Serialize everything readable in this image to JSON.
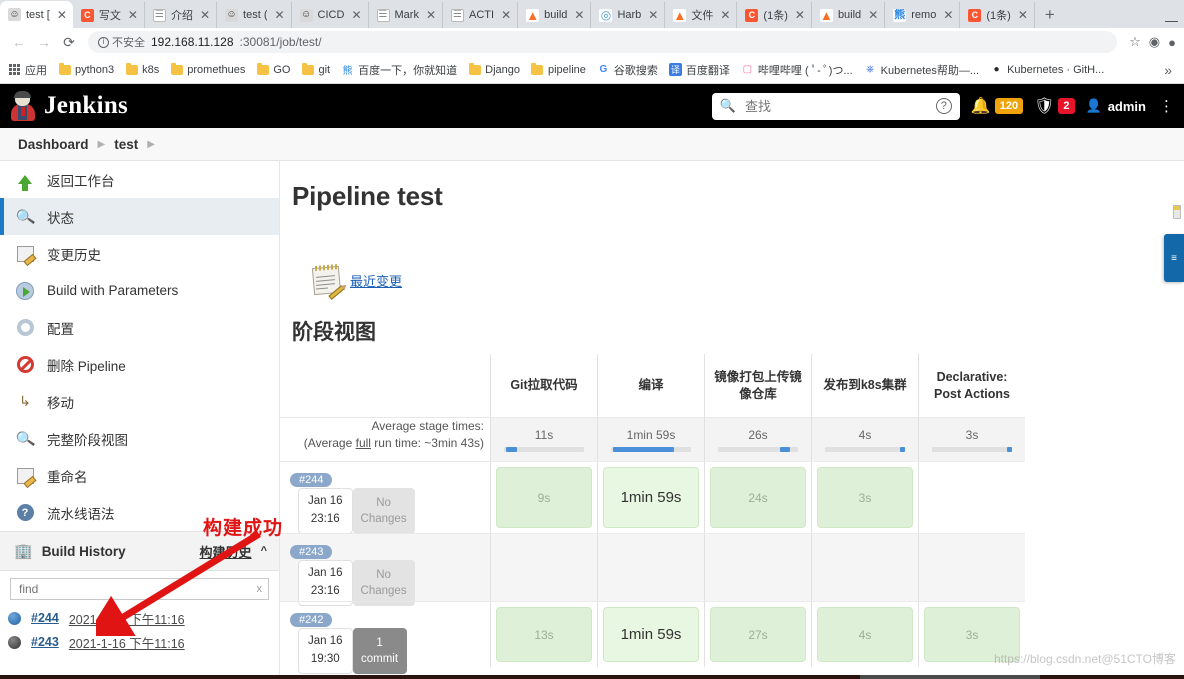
{
  "browser": {
    "tabs": [
      {
        "label": "test [",
        "icon": "jenkins-favicon",
        "active": true
      },
      {
        "label": "写文",
        "icon": "csdn-favicon",
        "active": false
      },
      {
        "label": "介绍",
        "icon": "doc-favicon",
        "active": false
      },
      {
        "label": "test (",
        "icon": "jenkins-favicon",
        "active": false
      },
      {
        "label": "CICD",
        "icon": "jenkins-favicon",
        "active": false
      },
      {
        "label": "Mark",
        "icon": "doc-favicon",
        "active": false
      },
      {
        "label": "ACTI",
        "icon": "doc-favicon",
        "active": false
      },
      {
        "label": "build",
        "icon": "gitlab-favicon",
        "active": false
      },
      {
        "label": "Harb",
        "icon": "harbor-favicon",
        "active": false
      },
      {
        "label": "文件",
        "icon": "gitlab-favicon",
        "active": false
      },
      {
        "label": "(1条)",
        "icon": "csdn-favicon",
        "active": false
      },
      {
        "label": "build",
        "icon": "gitlab-favicon",
        "active": false
      },
      {
        "label": "remo",
        "icon": "baidu-favicon",
        "active": false
      },
      {
        "label": "(1条)",
        "icon": "csdn-favicon",
        "active": false
      }
    ],
    "new_tab_label": "+",
    "minimize_label": "—",
    "security_label": "不安全",
    "url_host": "192.168.11.128",
    "url_rest": ":30081/job/test/",
    "bookmarks": [
      {
        "label": "应用",
        "icon": "apps-grid-icon"
      },
      {
        "label": "python3",
        "icon": "folder-icon"
      },
      {
        "label": "k8s",
        "icon": "folder-icon"
      },
      {
        "label": "promethues",
        "icon": "folder-icon"
      },
      {
        "label": "GO",
        "icon": "folder-icon"
      },
      {
        "label": "git",
        "icon": "folder-icon"
      },
      {
        "label": "百度一下，你就知道",
        "icon": "baidu-icon"
      },
      {
        "label": "Django",
        "icon": "folder-icon"
      },
      {
        "label": "pipeline",
        "icon": "folder-icon"
      },
      {
        "label": "谷歌搜索",
        "icon": "google-icon"
      },
      {
        "label": "百度翻译",
        "icon": "translate-icon"
      },
      {
        "label": "哔哩哔哩 ( ﾟ- ﾟ)つ...",
        "icon": "bilibili-icon"
      },
      {
        "label": "Kubernetes帮助—...",
        "icon": "kubernetes-icon"
      },
      {
        "label": "Kubernetes · GitH...",
        "icon": "github-icon"
      }
    ],
    "bookmarks_overflow": "»"
  },
  "jenkins": {
    "brand": "Jenkins",
    "search_placeholder": "查找",
    "search_value": "",
    "notification_count": "120",
    "alert_count": "2",
    "user": "admin",
    "breadcrumbs": [
      "Dashboard",
      "test"
    ],
    "sidebar": [
      {
        "label": "返回工作台",
        "icon": "up-arrow-icon",
        "active": false
      },
      {
        "label": "状态",
        "icon": "magnifier-icon",
        "active": true
      },
      {
        "label": "变更历史",
        "icon": "notepad-pencil-icon",
        "active": false
      },
      {
        "label": "Build with Parameters",
        "icon": "play-param-icon",
        "active": false
      },
      {
        "label": "配置",
        "icon": "gear-icon",
        "active": false
      },
      {
        "label": "删除 Pipeline",
        "icon": "delete-icon",
        "active": false
      },
      {
        "label": "移动",
        "icon": "move-icon",
        "active": false
      },
      {
        "label": "完整阶段视图",
        "icon": "magnifier-icon",
        "active": false
      },
      {
        "label": "重命名",
        "icon": "notepad-pencil-icon",
        "active": false
      },
      {
        "label": "流水线语法",
        "icon": "help-icon",
        "active": false
      }
    ],
    "build_history": {
      "title": "Build History",
      "link_label": "构建历史",
      "collapse_icon": "chevron-up-icon",
      "find_placeholder": "find",
      "find_value": "",
      "clear_label": "x",
      "builds": [
        {
          "number": "#244",
          "time": "2021-1-16 下午11:16",
          "status": "blue"
        },
        {
          "number": "#243",
          "time": "2021-1-16 下午11:16",
          "status": "grey"
        }
      ]
    }
  },
  "main": {
    "page_title": "Pipeline test",
    "recent_changes_label": "最近变更",
    "recent_changes_icon": "notepad-pencil-icon",
    "stage_view_title": "阶段视图",
    "average_stage_times_label": "Average stage times:",
    "average_run_prefix": "(Average ",
    "average_run_underline": "full",
    "average_run_suffix": " run time: ~3min 43s)"
  },
  "annotation": {
    "text": "构建成功",
    "color": "#e11414"
  },
  "float_tab": {
    "icon": "sidebar-toggle-icon",
    "color": "#1268a8"
  },
  "watermark": "https://blog.csdn.net@51CTO博客",
  "chart_data": {
    "type": "table",
    "title": "阶段视图 (Stage View)",
    "stages": [
      "Git拉取代码",
      "编译",
      "镜像打包上传镜像仓库",
      "发布到k8s集群",
      "Declarative: Post Actions"
    ],
    "average_stage_times": [
      "11s",
      "1min 59s",
      "26s",
      "4s",
      "3s"
    ],
    "average_bar_fill_pct": [
      10,
      82,
      90,
      96,
      98
    ],
    "average_full_run_time": "~3min 43s",
    "rows": [
      {
        "build": "#244",
        "date": "Jan 16",
        "time": "23:16",
        "changes_line1": "No",
        "changes_line2": "Changes",
        "changes_type": "none",
        "cells": [
          {
            "value": "9s",
            "state": "green"
          },
          {
            "value": "1min 59s",
            "state": "green-slow"
          },
          {
            "value": "24s",
            "state": "green"
          },
          {
            "value": "3s",
            "state": "green"
          },
          {
            "value": "",
            "state": "empty"
          }
        ]
      },
      {
        "build": "#243",
        "date": "Jan 16",
        "time": "23:16",
        "changes_line1": "No",
        "changes_line2": "Changes",
        "changes_type": "none",
        "cells": [
          {
            "value": "",
            "state": "empty"
          },
          {
            "value": "",
            "state": "empty"
          },
          {
            "value": "",
            "state": "empty"
          },
          {
            "value": "",
            "state": "empty"
          },
          {
            "value": "",
            "state": "empty"
          }
        ]
      },
      {
        "build": "#242",
        "date": "Jan 16",
        "time": "19:30",
        "changes_line1": "1",
        "changes_line2": "commit",
        "changes_type": "commit",
        "cells": [
          {
            "value": "13s",
            "state": "green"
          },
          {
            "value": "1min 59s",
            "state": "green-slow"
          },
          {
            "value": "27s",
            "state": "green"
          },
          {
            "value": "4s",
            "state": "green"
          },
          {
            "value": "3s",
            "state": "green"
          }
        ]
      }
    ]
  }
}
